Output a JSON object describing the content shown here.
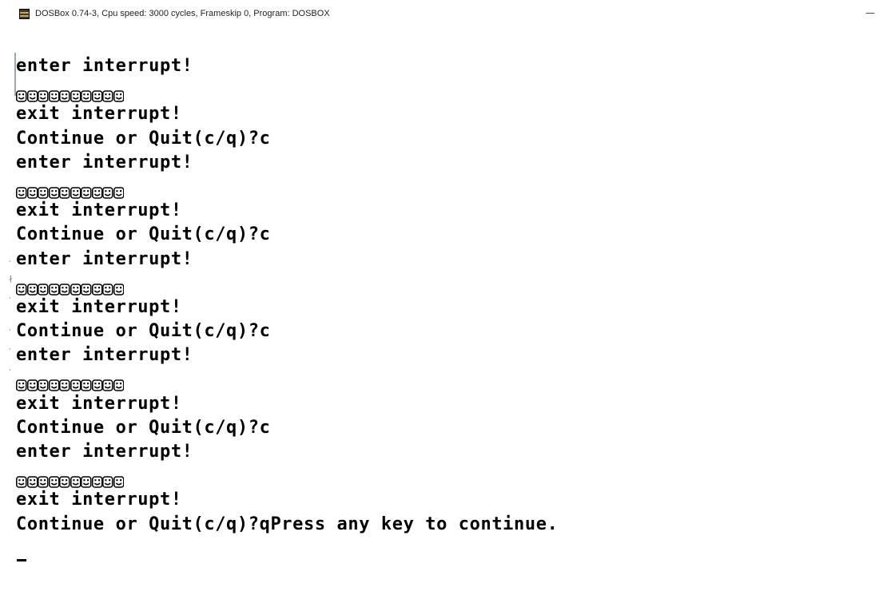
{
  "window": {
    "title": "DOSBox 0.74-3, Cpu speed:    3000 cycles, Frameskip  0, Program:   DOSBOX",
    "minimize_glyph": "—"
  },
  "icons": {
    "app": "dosbox-icon",
    "face": "smiley-face-icon"
  },
  "console": {
    "face_count": 10,
    "lines": [
      {
        "type": "text",
        "text": "enter interrupt!"
      },
      {
        "type": "faces"
      },
      {
        "type": "text",
        "text": "exit interrupt!"
      },
      {
        "type": "text",
        "text": "Continue or Quit(c/q)?c"
      },
      {
        "type": "text",
        "text": "enter interrupt!"
      },
      {
        "type": "faces"
      },
      {
        "type": "text",
        "text": "exit interrupt!"
      },
      {
        "type": "text",
        "text": "Continue or Quit(c/q)?c"
      },
      {
        "type": "text",
        "text": "enter interrupt!"
      },
      {
        "type": "faces"
      },
      {
        "type": "text",
        "text": "exit interrupt!"
      },
      {
        "type": "text",
        "text": "Continue or Quit(c/q)?c"
      },
      {
        "type": "text",
        "text": "enter interrupt!"
      },
      {
        "type": "faces"
      },
      {
        "type": "text",
        "text": "exit interrupt!"
      },
      {
        "type": "text",
        "text": "Continue or Quit(c/q)?c"
      },
      {
        "type": "text",
        "text": "enter interrupt!"
      },
      {
        "type": "faces"
      },
      {
        "type": "text",
        "text": "exit interrupt!"
      },
      {
        "type": "text",
        "text": "Continue or Quit(c/q)?qPress any key to continue."
      }
    ]
  },
  "colors": {
    "background": "#ffffff",
    "text": "#000000"
  }
}
